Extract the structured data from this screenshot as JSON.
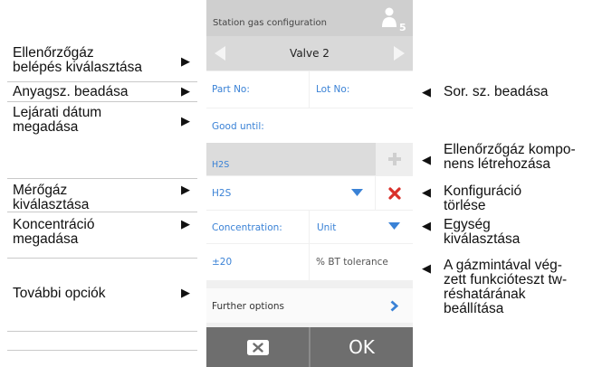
{
  "screen": {
    "title": "Station gas configuration",
    "user_badge": "5",
    "valve_label": "Valve 2",
    "part_no_label": "Part No:",
    "lot_no_label": "Lot No:",
    "good_until_label": "Good until:",
    "component_name": "H2S",
    "gas_select_value": "H2S",
    "concentration_label": "Concentration:",
    "unit_select_value": "Unit",
    "tolerance_value": "±20",
    "tolerance_unit_label": "% BT tolerance",
    "further_options_label": "Further options",
    "ok_label": "OK"
  },
  "left_annotations": [
    {
      "line1": "Ellenőrzőgáz",
      "line2": "belépés kiválasztása"
    },
    {
      "line1": "Anyagsz. beadása",
      "line2": ""
    },
    {
      "line1": "Lejárati dátum",
      "line2": "megadása"
    },
    {
      "line1": "Mérőgáz",
      "line2": "kiválasztása"
    },
    {
      "line1": "Koncentráció",
      "line2": "megadása"
    },
    {
      "line1": "További opciók",
      "line2": ""
    }
  ],
  "right_annotations": [
    {
      "lines": [
        "Sor. sz. beadása"
      ]
    },
    {
      "lines": [
        "Ellenőrzőgáz kompo-",
        "nens létrehozása"
      ]
    },
    {
      "lines": [
        "Konfiguráció",
        "törlése"
      ]
    },
    {
      "lines": [
        "Egység",
        "kiválasztása"
      ]
    },
    {
      "lines": [
        "A gázmintával vég-",
        "zett funkcióteszt tw-",
        "réshatárának",
        "beállítása"
      ]
    }
  ],
  "arrow_right": "▶",
  "arrow_left": "◀",
  "colors": {
    "accent_blue": "#3a82d6",
    "delete_red": "#d9302a",
    "footer_grey": "#6e6e6e"
  },
  "icons": [
    "user-icon",
    "chevron-left-icon",
    "chevron-right-icon",
    "plus-icon",
    "dropdown-arrow-icon",
    "delete-x-icon",
    "chevron-right-blue-icon",
    "cancel-x-icon"
  ]
}
